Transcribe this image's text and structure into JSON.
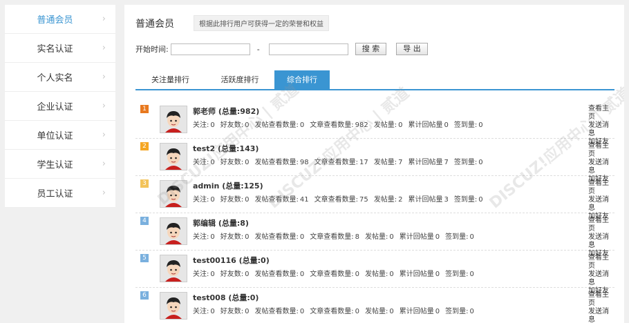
{
  "sidebar": {
    "items": [
      {
        "label": "普通会员",
        "active": true
      },
      {
        "label": "实名认证"
      },
      {
        "label": "个人实名"
      },
      {
        "label": "企业认证"
      },
      {
        "label": "单位认证"
      },
      {
        "label": "学生认证"
      },
      {
        "label": "员工认证"
      }
    ],
    "chevron": "›"
  },
  "header": {
    "title": "普通会员",
    "desc": "根据此排行用户可获得一定的荣誉和权益"
  },
  "filter": {
    "start_label": "开始时间:",
    "dash": "-",
    "search_label": "搜 索",
    "export_label": "导 出"
  },
  "tabs": [
    "关注量排行",
    "活跃度排行",
    "综合排行"
  ],
  "active_tab_index": 2,
  "rank_colors": {
    "1": "#e8791f",
    "2": "#f5a623",
    "3": "#f3c35a",
    "other": "#7ab0de"
  },
  "stat_labels": {
    "follow": "关注:",
    "friends": "好友数:",
    "views": "发帖查看数量:",
    "article_views": "文章查看数量:",
    "posts": "发帖量:",
    "replies": "累计回帖量",
    "checkin": "签到量:"
  },
  "actions": {
    "home": "查看主页",
    "message": "发送消息",
    "add_friend": "加好友"
  },
  "users": [
    {
      "rank": "1",
      "name": "郭老师 (总量:982)",
      "follow": "0",
      "friends": "0",
      "views": "0",
      "article_views": "982",
      "posts": "0",
      "replies": "0",
      "checkin": "0"
    },
    {
      "rank": "2",
      "name": "test2 (总量:143)",
      "follow": "0",
      "friends": "0",
      "views": "98",
      "article_views": "17",
      "posts": "7",
      "replies": "7",
      "checkin": "0"
    },
    {
      "rank": "3",
      "name": "admin (总量:125)",
      "follow": "0",
      "friends": "0",
      "views": "41",
      "article_views": "75",
      "posts": "2",
      "replies": "3",
      "checkin": "0"
    },
    {
      "rank": "4",
      "name": "郭编辑 (总量:8)",
      "follow": "0",
      "friends": "0",
      "views": "0",
      "article_views": "8",
      "posts": "0",
      "replies": "0",
      "checkin": "0"
    },
    {
      "rank": "5",
      "name": "test00116 (总量:0)",
      "follow": "0",
      "friends": "0",
      "views": "0",
      "article_views": "0",
      "posts": "0",
      "replies": "0",
      "checkin": "0"
    },
    {
      "rank": "6",
      "name": "test008 (总量:0)",
      "follow": "0",
      "friends": "0",
      "views": "0",
      "article_views": "0",
      "posts": "0",
      "replies": "0",
      "checkin": "0"
    }
  ],
  "watermark": "DISCUZ!应用中心 | 贰道"
}
